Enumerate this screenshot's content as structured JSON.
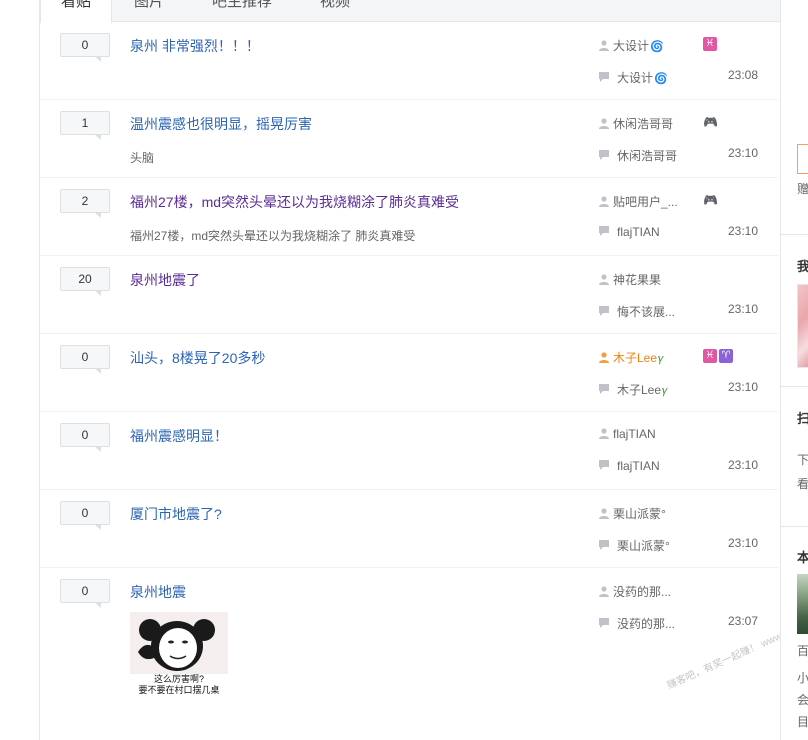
{
  "tabs": [
    {
      "label": "看贴",
      "active": true
    },
    {
      "label": "图片",
      "active": false
    },
    {
      "label": "吧主推荐",
      "active": false
    },
    {
      "label": "视频",
      "active": false
    }
  ],
  "threads": [
    {
      "replies": "0",
      "title": "泉州 非常强烈！！！",
      "abstract": "",
      "author": "大设计",
      "last_reply_user": "大设计",
      "time": "23:08"
    },
    {
      "replies": "1",
      "title": "温州震感也很明显，摇晃厉害",
      "abstract": "头脑",
      "author": "休闲浩哥哥",
      "last_reply_user": "休闲浩哥哥",
      "time": "23:10"
    },
    {
      "replies": "2",
      "title": "福州27楼，md突然头晕还以为我烧糊涂了肺炎真难受",
      "abstract": "福州27楼，md突然头晕还以为我烧糊涂了 肺炎真难受",
      "author": "贴吧用户_...",
      "last_reply_user": "flajTIAN",
      "time": "23:10"
    },
    {
      "replies": "20",
      "title": "泉州地震了",
      "abstract": "",
      "author": "神花果果",
      "last_reply_user": "悔不该展...",
      "time": "23:10"
    },
    {
      "replies": "0",
      "title": "汕头，8楼晃了20多秒",
      "abstract": "",
      "author": "木子Lee",
      "last_reply_user": "木子Lee",
      "time": "23:10"
    },
    {
      "replies": "0",
      "title": "福州震感明显！",
      "abstract": "",
      "author": "flajTIAN",
      "last_reply_user": "flajTIAN",
      "time": "23:10"
    },
    {
      "replies": "0",
      "title": "厦门市地震了?",
      "abstract": "",
      "author": "栗山派蒙°",
      "last_reply_user": "栗山派蒙°",
      "time": "23:10"
    },
    {
      "replies": "0",
      "title": "泉州地震",
      "abstract": "",
      "author": "没药的那...",
      "last_reply_user": "没药的那...",
      "time": "23:07",
      "image_caption": "这么厉害啊?\n要不要在村口摆几桌"
    }
  ],
  "sidebar": {
    "gift_label": "赠",
    "section1": "我",
    "section2": "扫",
    "download_1": "下",
    "download_2": "看",
    "section3": "本",
    "line_1": "百",
    "line_2": "小",
    "line_3": "会",
    "line_4": "目"
  },
  "watermark": "赚客吧，有奖一起赚！ www.zuanke8.com",
  "colors": {
    "link": "#2d64b3",
    "visited": "#5a2d94",
    "orange_user": "#f07f0f",
    "pisces_badge": "#e257a5",
    "aries_badge": "#8a63d6"
  }
}
